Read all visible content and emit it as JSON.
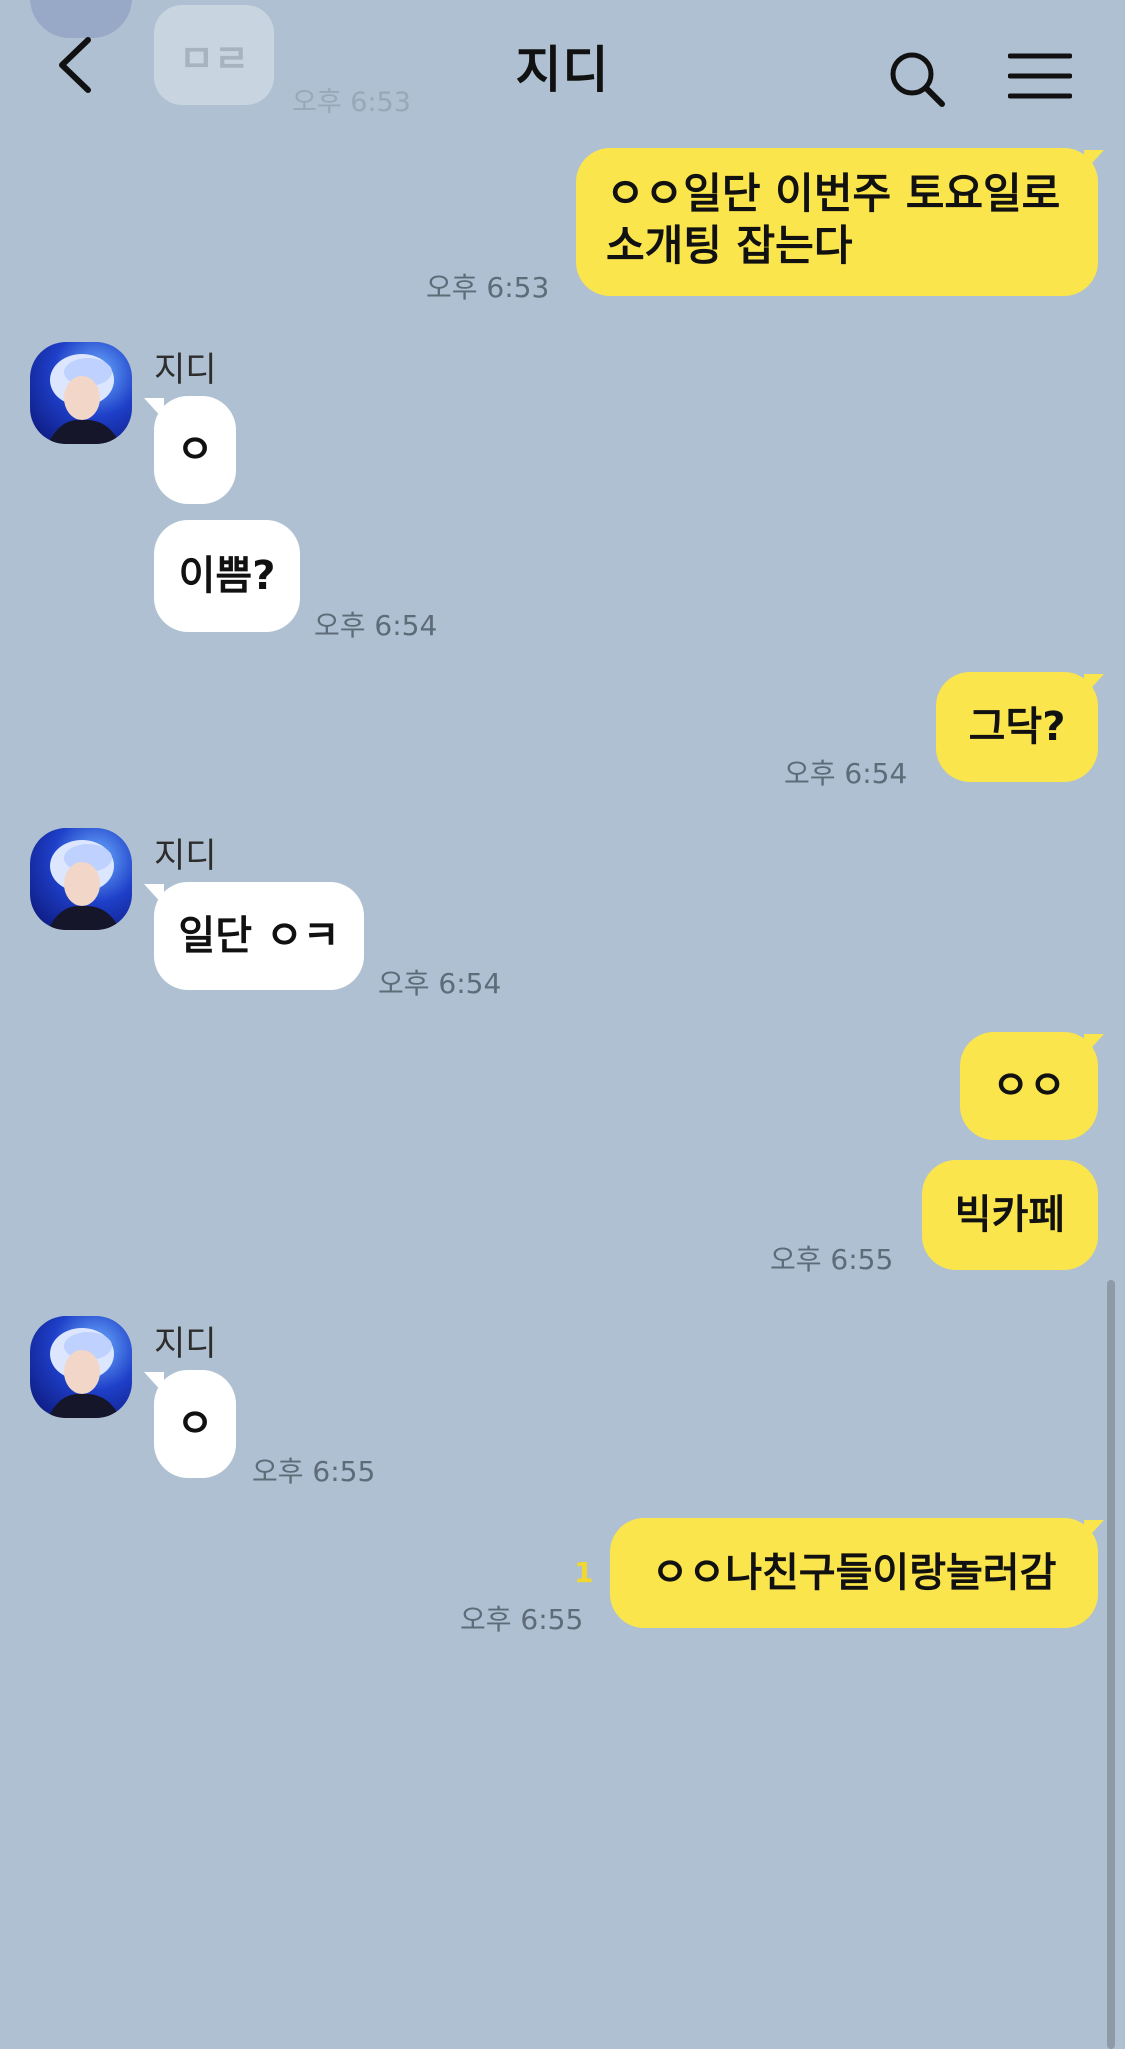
{
  "header": {
    "title": "지디",
    "back_icon": "chevron-left-icon",
    "search_icon": "search-icon",
    "menu_icon": "hamburger-menu-icon"
  },
  "colors": {
    "background": "#AEC0D1",
    "outgoing_bubble": "#FAE54D",
    "incoming_bubble": "#FFFFFF",
    "timestamp": "#5E6B78",
    "unread_count": "#F2D72E"
  },
  "faded_previous": {
    "text": "ㅁㄹ",
    "time": "오후 6:53"
  },
  "messages": [
    {
      "id": "m1",
      "direction": "out",
      "lines": [
        "ㅇㅇ일단 이번주 토요일로",
        "소개팅 잡는다"
      ],
      "time": "오후 6:53"
    },
    {
      "id": "m2",
      "direction": "in",
      "sender": "지디",
      "text": "ㅇ"
    },
    {
      "id": "m3",
      "direction": "in",
      "text": "이쁨?",
      "time": "오후 6:54"
    },
    {
      "id": "m4",
      "direction": "out",
      "text": "그닥?",
      "time": "오후 6:54"
    },
    {
      "id": "m5",
      "direction": "in",
      "sender": "지디",
      "text": "일단 ㅇㅋ",
      "time": "오후 6:54"
    },
    {
      "id": "m6",
      "direction": "out",
      "text": "ㅇㅇ"
    },
    {
      "id": "m7",
      "direction": "out",
      "text": "빅카페",
      "time": "오후 6:55"
    },
    {
      "id": "m8",
      "direction": "in",
      "sender": "지디",
      "text": "ㅇ",
      "time": "오후 6:55"
    },
    {
      "id": "m9",
      "direction": "out",
      "text": "ㅇㅇ나친구들이랑놀러감",
      "time": "오후 6:55",
      "unread": "1"
    }
  ]
}
